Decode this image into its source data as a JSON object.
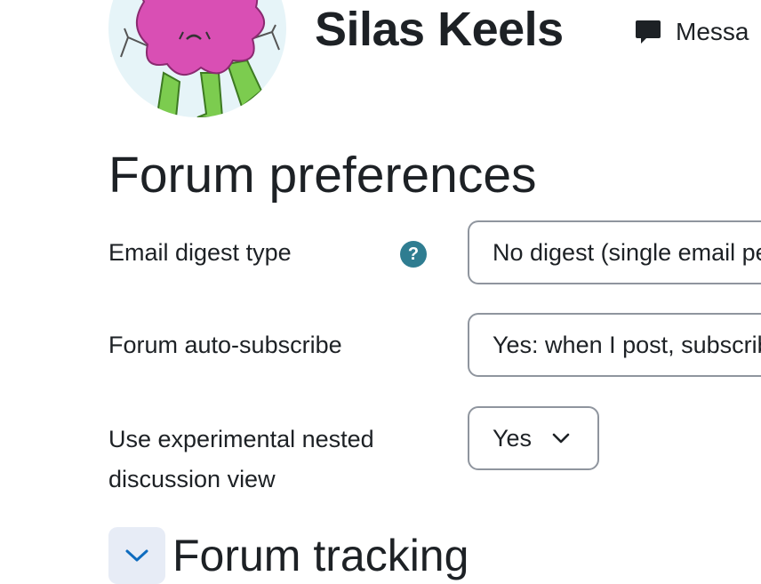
{
  "header": {
    "user_name": "Silas Keels",
    "message_label": "Messa",
    "avatar_icon": "user-avatar-monster",
    "message_icon": "speech-bubble-icon"
  },
  "page": {
    "title": "Forum preferences"
  },
  "form": {
    "email_digest": {
      "label": "Email digest type",
      "value": "No digest (single email per forum post)",
      "help_icon": "question-circle-icon",
      "help_symbol": "?"
    },
    "auto_subscribe": {
      "label": "Forum auto-subscribe",
      "value": "Yes: when I post, subscribe me to that forum discussion"
    },
    "nested_view": {
      "label_line1": "Use experimental nested",
      "label_line2": "discussion view",
      "value": "Yes"
    }
  },
  "section": {
    "heading": "Forum tracking",
    "collapse_icon": "chevron-down-icon"
  },
  "colors": {
    "help_icon_bg": "#2f7d91",
    "collapse_bg": "#e7ecf6",
    "accent": "#0f6cbf",
    "text": "#1d2125"
  }
}
